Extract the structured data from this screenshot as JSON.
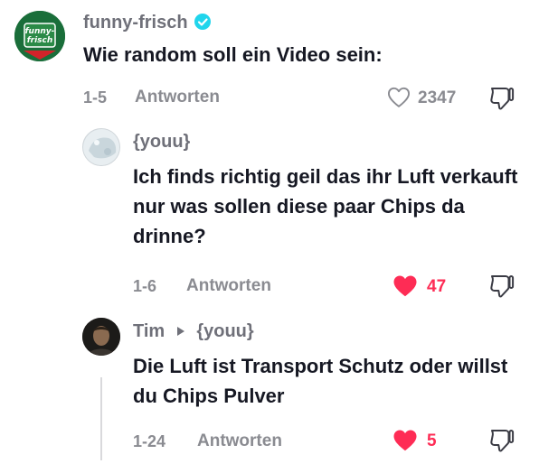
{
  "colors": {
    "like_active": "#fe2c55",
    "verified": "#20d5ec",
    "secondary_text": "#8a8b91"
  },
  "comments": [
    {
      "username": "funny-frisch",
      "verified": true,
      "avatar_text": "funny-\nfrisch",
      "text": "Wie random soll ein Video sein:",
      "date": "1-5",
      "reply_label": "Antworten",
      "likes": "2347",
      "liked": false
    },
    {
      "username": "{youu}",
      "text": "Ich finds richtig geil das ihr Luft verkauft nur was sollen diese paar Chips da drinne?",
      "date": "1-6",
      "reply_label": "Antworten",
      "likes": "47",
      "liked": true
    },
    {
      "username": "Tim",
      "reply_to": "{youu}",
      "text": "Die Luft ist Transport Schutz oder willst du Chips Pulver",
      "date": "1-24",
      "reply_label": "Antworten",
      "likes": "5",
      "liked": true
    }
  ]
}
